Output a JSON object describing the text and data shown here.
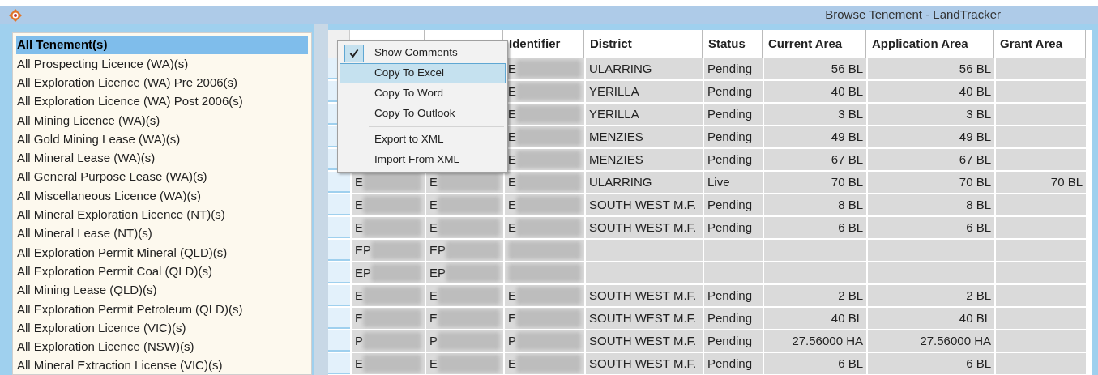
{
  "window": {
    "title": "Browse Tenement - LandTracker"
  },
  "sidebar": {
    "items": [
      {
        "label": "All Tenement(s)",
        "selected": true
      },
      {
        "label": "All Prospecting Licence (WA)(s)",
        "selected": false
      },
      {
        "label": "All Exploration Licence (WA) Pre 2006(s)",
        "selected": false
      },
      {
        "label": "All Exploration Licence (WA) Post 2006(s)",
        "selected": false
      },
      {
        "label": "All Mining Licence (WA)(s)",
        "selected": false
      },
      {
        "label": "All Gold Mining Lease (WA)(s)",
        "selected": false
      },
      {
        "label": "All Mineral Lease (WA)(s)",
        "selected": false
      },
      {
        "label": "All General Purpose Lease (WA)(s)",
        "selected": false
      },
      {
        "label": "All Miscellaneous Licence (WA)(s)",
        "selected": false
      },
      {
        "label": "All Mineral Exploration Licence (NT)(s)",
        "selected": false
      },
      {
        "label": "All Mineral Lease (NT)(s)",
        "selected": false
      },
      {
        "label": "All Exploration Permit Mineral (QLD)(s)",
        "selected": false
      },
      {
        "label": "All Exploration Permit Coal (QLD)(s)",
        "selected": false
      },
      {
        "label": "All Mining Lease (QLD)(s)",
        "selected": false
      },
      {
        "label": "All Exploration Permit Petroleum (QLD)(s)",
        "selected": false
      },
      {
        "label": "All Exploration Licence (VIC)(s)",
        "selected": false
      },
      {
        "label": "All Exploration Licence (NSW)(s)",
        "selected": false
      },
      {
        "label": "All Mineral Extraction License (VIC)(s)",
        "selected": false
      }
    ]
  },
  "table": {
    "columns": [
      "Identifier",
      "District",
      "Status",
      "Current Area",
      "Application Area",
      "Grant Area"
    ],
    "rows": [
      {
        "identifier": "E",
        "district": "ULARRING",
        "status": "Pending",
        "current_area": "56 BL",
        "application_area": "56 BL"
      },
      {
        "identifier": "E",
        "district": "YERILLA",
        "status": "Pending",
        "current_area": "40 BL",
        "application_area": "40 BL"
      },
      {
        "identifier": "E",
        "district": "YERILLA",
        "status": "Pending",
        "current_area": "3 BL",
        "application_area": "3 BL"
      },
      {
        "identifier": "E",
        "district": "MENZIES",
        "status": "Pending",
        "current_area": "49 BL",
        "application_area": "49 BL"
      },
      {
        "identifier": "E",
        "district": "MENZIES",
        "status": "Pending",
        "current_area": "67 BL",
        "application_area": "67 BL"
      },
      {
        "column_1": "E",
        "column_2": "E",
        "identifier": "E",
        "district": "ULARRING",
        "status": "Live",
        "current_area": "70 BL",
        "application_area": "70 BL",
        "grant_area": "70 BL"
      },
      {
        "column_1": "E",
        "column_2": "E",
        "identifier": "E",
        "district": "SOUTH WEST M.F.",
        "status": "Pending",
        "current_area": "8 BL",
        "application_area": "8 BL"
      },
      {
        "column_1": "E",
        "column_2": "E",
        "identifier": "E",
        "district": "SOUTH WEST M.F.",
        "status": "Pending",
        "current_area": "6 BL",
        "application_area": "6 BL"
      },
      {
        "column_1": "EP",
        "column_2": "EP"
      },
      {
        "column_1": "EP",
        "column_2": "EP"
      },
      {
        "column_1": "E",
        "column_2": "E",
        "identifier": "E",
        "district": "SOUTH WEST M.F.",
        "status": "Pending",
        "current_area": "2 BL",
        "application_area": "2 BL"
      },
      {
        "column_1": "E",
        "column_2": "E",
        "identifier": "E",
        "district": "SOUTH WEST M.F.",
        "status": "Pending",
        "current_area": "40 BL",
        "application_area": "40 BL"
      },
      {
        "column_1": "P",
        "column_2": "P",
        "identifier": "P",
        "district": "SOUTH WEST M.F.",
        "status": "Pending",
        "current_area": "27.56000 HA",
        "application_area": "27.56000 HA"
      },
      {
        "column_1": "E",
        "column_2": "E",
        "identifier": "E",
        "district": "SOUTH WEST M.F.",
        "status": "Pending",
        "current_area": "6 BL",
        "application_area": "6 BL"
      }
    ]
  },
  "context_menu": {
    "items": [
      {
        "kind": "check",
        "label": "Show Comments",
        "checked": true,
        "selected": false
      },
      {
        "kind": "item",
        "label": "Copy To Excel",
        "selected": true
      },
      {
        "kind": "item",
        "label": "Copy To Word",
        "selected": false
      },
      {
        "kind": "item",
        "label": "Copy To Outlook",
        "selected": false
      },
      {
        "kind": "separator"
      },
      {
        "kind": "item",
        "label": "Export to XML",
        "selected": false
      },
      {
        "kind": "item",
        "label": "Import From XML",
        "selected": false
      }
    ]
  }
}
